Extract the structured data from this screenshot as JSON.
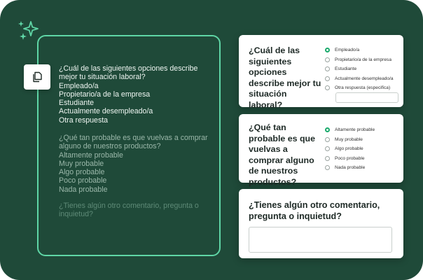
{
  "colors": {
    "background": "#1f4a39",
    "accent": "#5fd6a6",
    "selected_radio": "#1aaa6c"
  },
  "plain_text": {
    "question1": {
      "prompt": "¿Cuál de las siguientes opciones describe mejor tu situación laboral?",
      "options": [
        "Empleado/a",
        "Propietario/a de la empresa",
        "Estudiante",
        "Actualmente desempleado/a",
        "Otra respuesta"
      ]
    },
    "question2": {
      "prompt": "¿Qué tan probable es que vuelvas a comprar alguno de nuestros productos?",
      "options": [
        "Altamente probable",
        "Muy probable",
        "Algo probable",
        "Poco probable",
        "Nada probable"
      ]
    },
    "question3": {
      "prompt": "¿Tienes algún otro comentario, pregunta o inquietud?"
    }
  },
  "survey": {
    "card1": {
      "title": "¿Cuál de las siguientes opciones describe mejor tu situación laboral?",
      "options": [
        "Empleado/a",
        "Propietario/a de la empresa",
        "Estudiante",
        "Actualmente desempleado/a",
        "Otra respuesta (especifica)"
      ],
      "selected": "Empleado/a",
      "other_value": ""
    },
    "card2": {
      "title": "¿Qué tan probable es que vuelvas a comprar alguno de nuestros productos?",
      "options": [
        "Altamente probable",
        "Muy probable",
        "Algo probable",
        "Poco probable",
        "Nada probable"
      ],
      "selected": "Altamente probable"
    },
    "card3": {
      "title": "¿Tienes algún otro comentario, pregunta o inquietud?",
      "value": ""
    }
  },
  "icons": {
    "sparkle": "sparkle-icon",
    "copy": "copy-icon"
  }
}
